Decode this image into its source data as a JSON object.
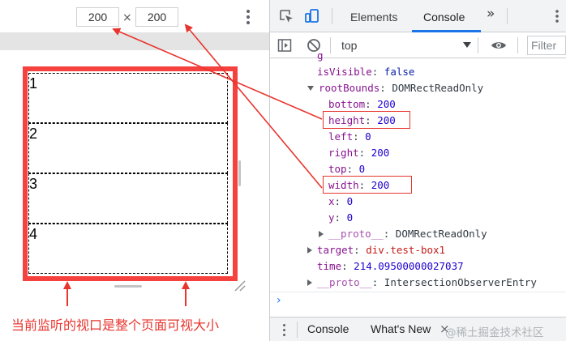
{
  "device_toolbar": {
    "width_value": "200",
    "height_value": "200",
    "times_symbol": "×"
  },
  "test_boxes": [
    "1",
    "2",
    "3",
    "4"
  ],
  "annotation_text": "当前监听的视口是整个页面可视大小",
  "devtools": {
    "tabs": [
      "Elements",
      "Console"
    ],
    "more_tabs_glyph": "»",
    "context_value": "top",
    "filter_placeholder": "Filter"
  },
  "console_lines": [
    {
      "key": "isVisible",
      "value": "false",
      "vclass": "v-kw"
    },
    {
      "key": "rootBounds",
      "value": "DOMRectReadOnly",
      "vclass": "v-plain"
    },
    {
      "key": "bottom",
      "value": "200",
      "vclass": "v-num"
    },
    {
      "key": "height",
      "value": "200",
      "vclass": "v-num"
    },
    {
      "key": "left",
      "value": "0",
      "vclass": "v-num"
    },
    {
      "key": "right",
      "value": "200",
      "vclass": "v-num"
    },
    {
      "key": "top",
      "value": "0",
      "vclass": "v-num"
    },
    {
      "key": "width",
      "value": "200",
      "vclass": "v-num"
    },
    {
      "key": "x",
      "value": "0",
      "vclass": "v-num"
    },
    {
      "key": "y",
      "value": "0",
      "vclass": "v-num"
    },
    {
      "key": "__proto__",
      "value": "DOMRectReadOnly",
      "vclass": "v-plain"
    },
    {
      "key": "target",
      "value": "div.test-box1",
      "vclass": "v-str"
    },
    {
      "key": "time",
      "value": "214.09500000027037",
      "vclass": "v-num"
    },
    {
      "key": "__proto__",
      "value": "IntersectionObserverEntry",
      "vclass": "v-plain"
    }
  ],
  "prompt_glyph": "›",
  "drawer": {
    "tabs": [
      "Console",
      "What's New"
    ],
    "close_glyph": "×",
    "watermark": "@稀土掘金技术社区"
  },
  "colors": {
    "annotation_red": "#f5423f",
    "active_tab_blue": "#1a73e8"
  },
  "icons": [
    "inspect-element-icon",
    "device-toolbar-icon",
    "sidebar-toggle-icon",
    "clear-console-icon",
    "eye-icon",
    "more-options-icon"
  ]
}
